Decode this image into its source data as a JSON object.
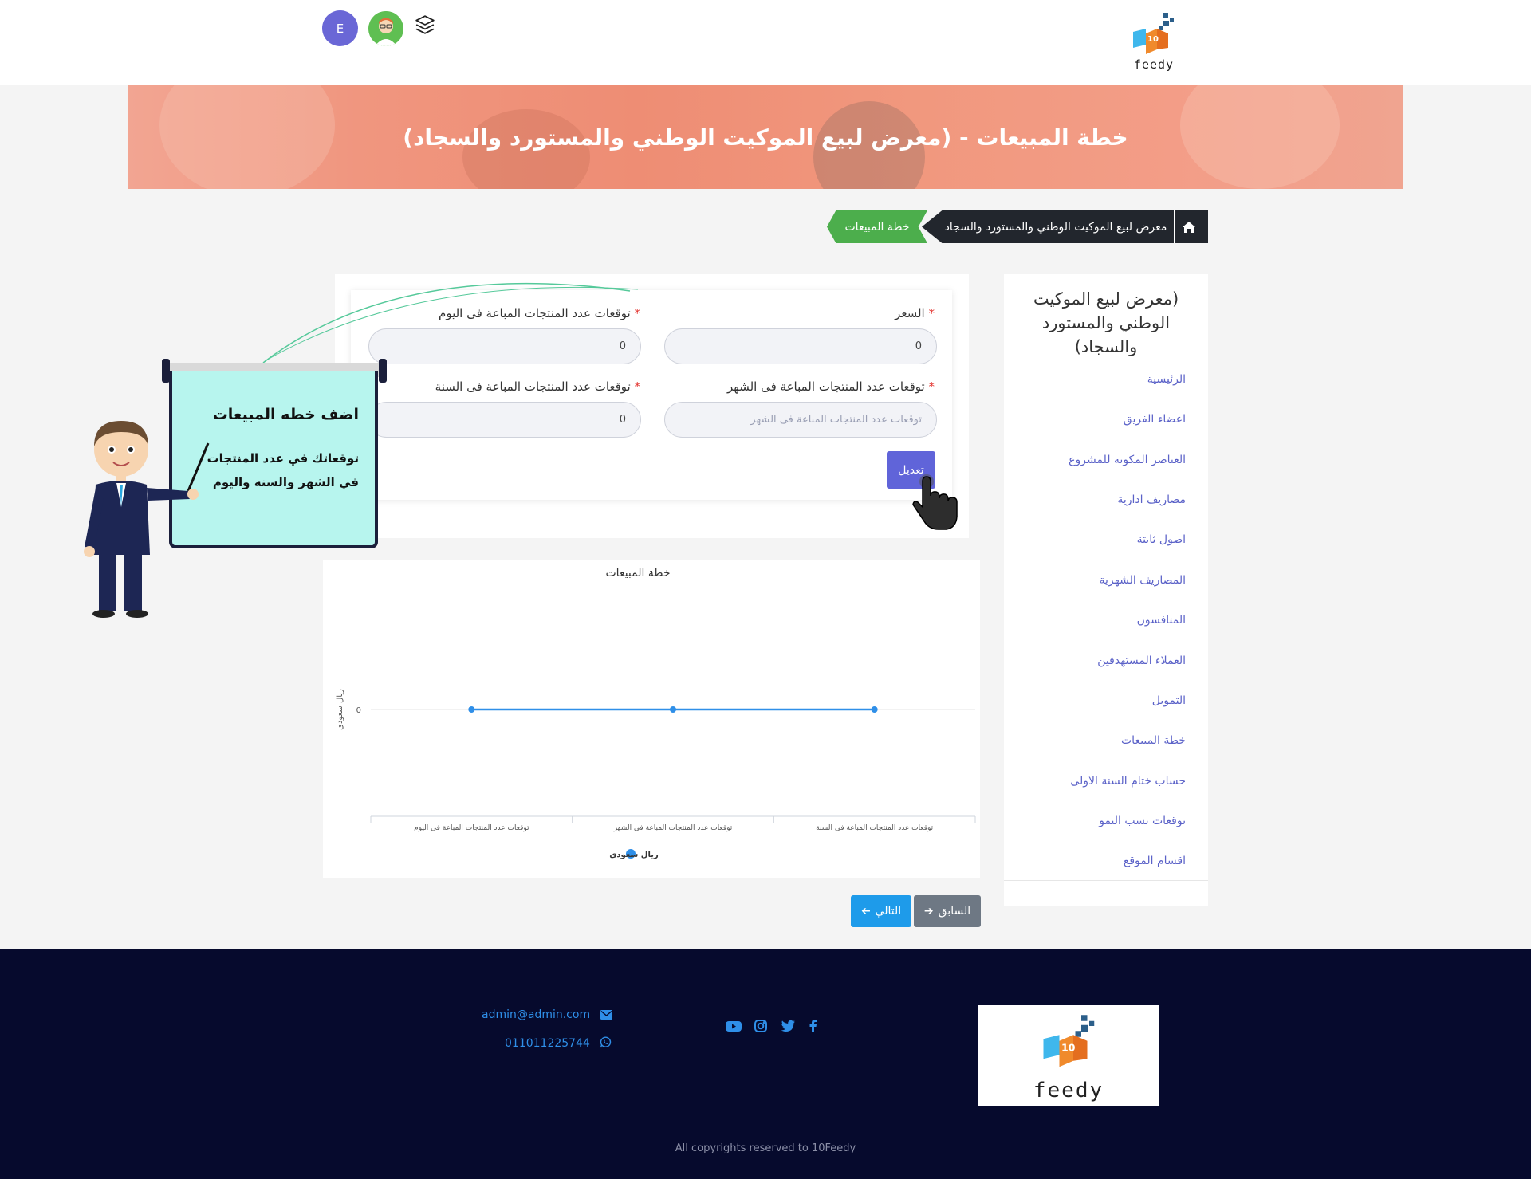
{
  "header": {
    "brand": "feedy",
    "brand_num": "10",
    "avatar_initial": "E"
  },
  "banner": {
    "title": "خطة المبيعات - (معرض لبيع الموكيت الوطني والمستورد والسجاد)"
  },
  "breadcrumb": {
    "project": "معرض لبيع الموكيت الوطني والمستورد والسجاد",
    "current": "خطة المبيعات"
  },
  "sidebar": {
    "title": "(معرض لبيع الموكيت الوطني والمستورد والسجاد)",
    "items": [
      {
        "label": "الرئيسية"
      },
      {
        "label": "اعضاء الفريق"
      },
      {
        "label": "العناصر المكونة للمشروع"
      },
      {
        "label": "مصاريف ادارية"
      },
      {
        "label": "اصول ثابتة"
      },
      {
        "label": "المصاريف الشهرية"
      },
      {
        "label": "المنافسون"
      },
      {
        "label": "العملاء المستهدفين"
      },
      {
        "label": "التمويل"
      },
      {
        "label": "خطة المبيعات"
      },
      {
        "label": "حساب ختام السنة الاولى"
      },
      {
        "label": "توقعات نسب النمو"
      },
      {
        "label": "اقسام الموقع"
      }
    ]
  },
  "form": {
    "price": {
      "label": "السعر",
      "value": "0"
    },
    "per_day": {
      "label": "توقعات عدد المنتجات المباعة فى اليوم",
      "value": "0"
    },
    "per_month": {
      "label": "توقعات عدد المنتجات المباعة فى الشهر",
      "value": "",
      "placeholder": "توقعات عدد المنتجات المباعة فى الشهر"
    },
    "per_year": {
      "label": "توقعات عدد المنتجات المباعة فى السنة",
      "value": "0"
    },
    "required_mark": "*",
    "edit_button": "تعديل"
  },
  "chart_data": {
    "type": "line",
    "title": "خطة المبيعات",
    "ylabel": "ريال سعودي",
    "categories": [
      "توقعات عدد المنتجات المباعة فى اليوم",
      "توقعات عدد المنتجات المباعة فى الشهر",
      "توقعات عدد المنتجات المباعة فى السنة"
    ],
    "series": [
      {
        "name": "ريال سعودي",
        "values": [
          0,
          0,
          0
        ],
        "color": "#2f8fe8"
      }
    ],
    "y_ticks": [
      "0"
    ],
    "legend": "bottom",
    "grid": true
  },
  "nav": {
    "prev": "السابق",
    "next": "التالي"
  },
  "promo": {
    "title": "اضف خطه المبيعات",
    "text": "توقعاتك في عدد المنتجات في الشهر والسنه واليوم"
  },
  "footer": {
    "email": "admin@admin.com",
    "phone": "011011225744",
    "copyright": "All copyrights reserved to 10Feedy",
    "social": [
      "facebook-icon",
      "twitter-icon",
      "instagram-icon",
      "youtube-icon"
    ]
  },
  "colors": {
    "accent": "#6064d9",
    "breadcrumb_dark": "#22262d",
    "breadcrumb_green": "#4cae4c",
    "footer_bg": "#060a2d",
    "link": "#5b62c8"
  }
}
